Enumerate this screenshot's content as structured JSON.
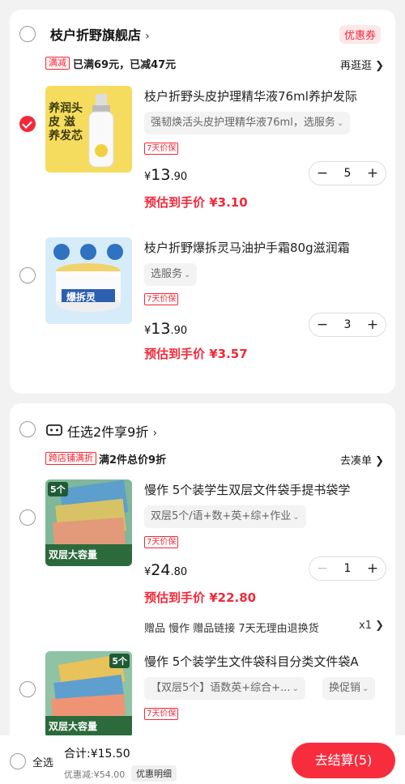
{
  "colors": {
    "accent": "#f2293a",
    "background": "#f2f2f2"
  },
  "store1": {
    "name": "枝户折野旗舰店",
    "chevron": "›",
    "coupon": "优惠券",
    "promo_tag": "满减",
    "promo_text": "已满69元，已减47元",
    "promo_link": "再逛逛 ❯",
    "items": [
      {
        "title": "枝户折野头皮护理精华液76ml养护发际",
        "sku": "强韧焕活头皮护理精华液76ml，选服务",
        "badge": "7天价保",
        "price_symbol": "¥",
        "price_int": "13",
        "price_dec": ".90",
        "estimate": "预估到手价 ¥3.10",
        "qty": "5",
        "checked": true,
        "thumb_text": "养润头皮 滋养发芯"
      },
      {
        "title": "枝户折野爆拆灵马油护手霜80g滋润霜",
        "sku": "选服务",
        "badge": "7天价保",
        "price_symbol": "¥",
        "price_int": "13",
        "price_dec": ".90",
        "estimate": "预估到手价 ¥3.57",
        "qty": "3",
        "checked": false,
        "thumb_text": "爆拆灵"
      }
    ]
  },
  "store2": {
    "name": "任选2件享9折",
    "chevron": "›",
    "promo_tag": "跨店铺满折",
    "promo_text": "满2件总价9折",
    "promo_link": "去凑单 ❯",
    "items": [
      {
        "title": "慢作 5个装学生双层文件袋手提书袋学",
        "sku": "双层5个/语+数+英+综+作业",
        "badge": "7天价保",
        "price_symbol": "¥",
        "price_int": "24",
        "price_dec": ".80",
        "estimate": "预估到手价 ¥22.80",
        "qty": "1",
        "gift": "赠品  慢作 赠品链接 7天无理由退换货",
        "gift_qty": "x1 ❯",
        "thumb_badge": "5个",
        "thumb_text": "双层大容量"
      },
      {
        "title": "慢作 5个装学生文件袋科目分类文件袋A",
        "sku": "【双层5个】语数英+综合+...",
        "sku2": "换促销",
        "badge": "7天价保",
        "thumb_badge": "5个",
        "thumb_text": "双层大容量"
      }
    ]
  },
  "bottom": {
    "select_all": "全选",
    "total": "合计:¥15.50",
    "discount": "优惠减:¥54.00",
    "discount_detail": "优惠明细",
    "checkout": "去结算(5)"
  }
}
